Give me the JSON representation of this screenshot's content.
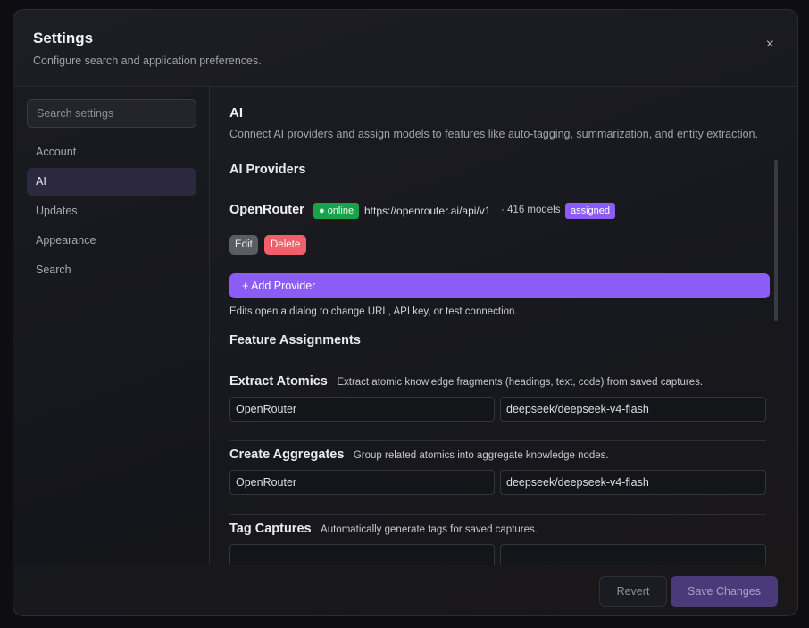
{
  "dialog": {
    "title": "Settings",
    "subtitle": "Configure search and application preferences.",
    "close_glyph": "×"
  },
  "sidebar": {
    "search_placeholder": "Search settings",
    "items": [
      {
        "label": "Account",
        "active": false
      },
      {
        "label": "AI",
        "active": true
      },
      {
        "label": "Updates",
        "active": false
      },
      {
        "label": "Appearance",
        "active": false
      },
      {
        "label": "Search",
        "active": false
      }
    ]
  },
  "main": {
    "title": "AI",
    "description": "Connect AI providers and assign models to features like auto-tagging, summarization, and entity extraction.",
    "providers_heading": "AI Providers",
    "provider": {
      "name": "OpenRouter",
      "status": "● online",
      "url": "https://openrouter.ai/api/v1",
      "models": "· 416 models",
      "assigned": "assigned",
      "edit_label": "Edit",
      "delete_label": "Delete"
    },
    "add_provider_label": "+ Add Provider",
    "add_hint": "Edits open a dialog to change URL, API key, or test connection.",
    "assignments_heading": "Feature Assignments",
    "features": [
      {
        "title": "Extract Atomics",
        "description": "Extract atomic knowledge fragments (headings, text, code) from saved captures.",
        "provider": "OpenRouter",
        "model": "deepseek/deepseek-v4-flash"
      },
      {
        "title": "Create Aggregates",
        "description": "Group related atomics into aggregate knowledge nodes.",
        "provider": "OpenRouter",
        "model": "deepseek/deepseek-v4-flash"
      },
      {
        "title": "Tag Captures",
        "description": "Automatically generate tags for saved captures.",
        "provider": "",
        "model": ""
      }
    ]
  },
  "footer": {
    "revert_label": "Revert",
    "save_label": "Save Changes"
  },
  "colors": {
    "accent": "#8b5cf6",
    "online": "#16a34a",
    "danger": "#f0606a",
    "active_nav": "#2b2840"
  }
}
